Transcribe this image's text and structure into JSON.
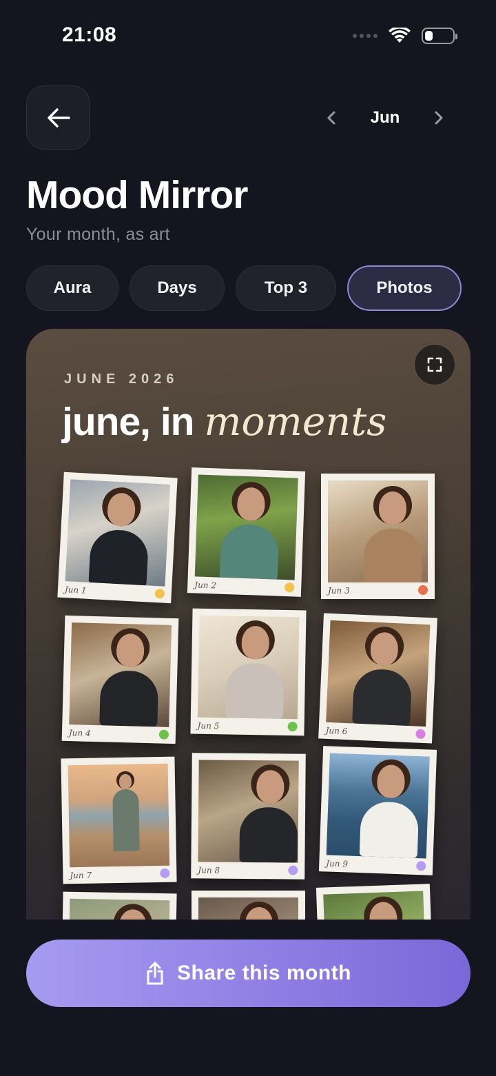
{
  "status_bar": {
    "time": "21:08"
  },
  "header": {
    "back_icon": "arrow-left-icon",
    "month": "Jun"
  },
  "title": "Mood Mirror",
  "subtitle": "Your month, as art",
  "tabs": [
    {
      "label": "Aura",
      "active": false
    },
    {
      "label": "Days",
      "active": false
    },
    {
      "label": "Top 3",
      "active": false
    },
    {
      "label": "Photos",
      "active": true
    }
  ],
  "card": {
    "eyebrow": "JUNE 2026",
    "headline_plain": "june, in",
    "headline_italic": "moments",
    "photos": [
      {
        "caption": "Jun 1",
        "mood_color": "#f2c14e"
      },
      {
        "caption": "Jun 2",
        "mood_color": "#f2c14e"
      },
      {
        "caption": "Jun 3",
        "mood_color": "#e8704f"
      },
      {
        "caption": "Jun 4",
        "mood_color": "#6cc24a"
      },
      {
        "caption": "Jun 5",
        "mood_color": "#6cc24a"
      },
      {
        "caption": "Jun 6",
        "mood_color": "#d77fe0"
      },
      {
        "caption": "Jun 7",
        "mood_color": "#b69cf0"
      },
      {
        "caption": "Jun 8",
        "mood_color": "#b69cf0"
      },
      {
        "caption": "Jun 9",
        "mood_color": "#b69cf0"
      }
    ]
  },
  "share_button": {
    "label": "Share this month",
    "icon": "share-icon"
  },
  "colors": {
    "accent": "#8f88d6",
    "background": "#15151f"
  }
}
